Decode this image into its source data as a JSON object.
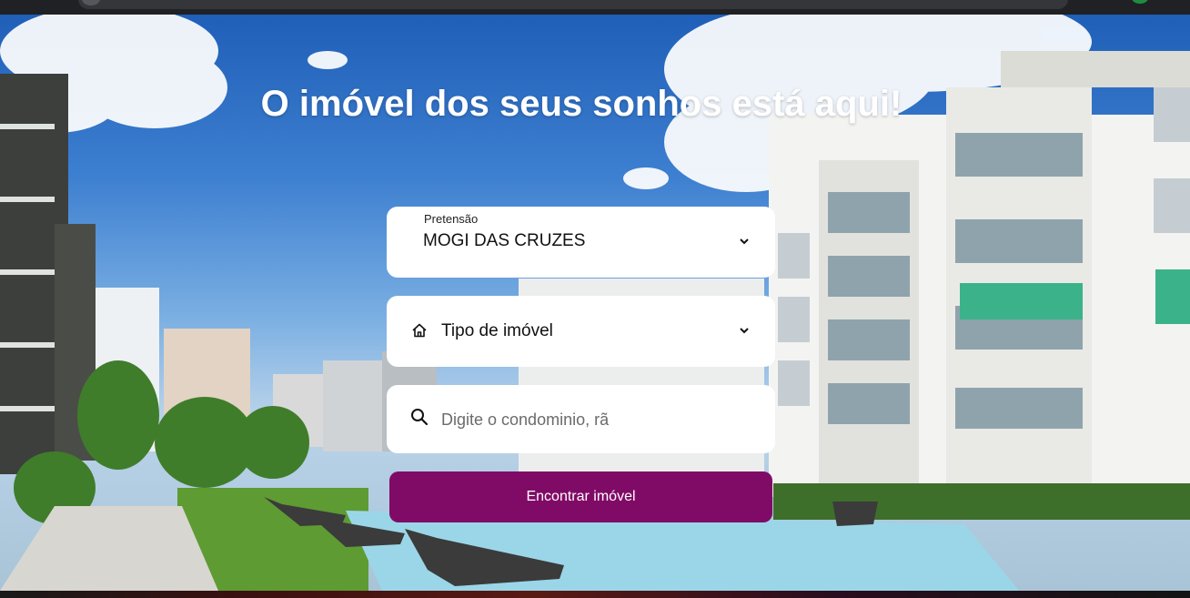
{
  "hero": {
    "headline": "O imóvel dos seus sonhos está aqui!",
    "background_image": "apartment-buildings-with-pool"
  },
  "search_form": {
    "pretensao": {
      "label": "Pretensão",
      "selected_value": "MOGI DAS CRUZES",
      "icon": "chevron-down-icon"
    },
    "tipo_imovel": {
      "label": "Tipo de imóvel",
      "icon": "house-icon",
      "dropdown_icon": "chevron-down-icon"
    },
    "busca": {
      "placeholder": "Digite o condominio, rã",
      "value": "",
      "icon": "search-icon"
    },
    "submit": {
      "label": "Encontrar imóvel"
    }
  },
  "colors": {
    "button": "#800b66",
    "headline": "#ffffff",
    "card": "#ffffff"
  }
}
